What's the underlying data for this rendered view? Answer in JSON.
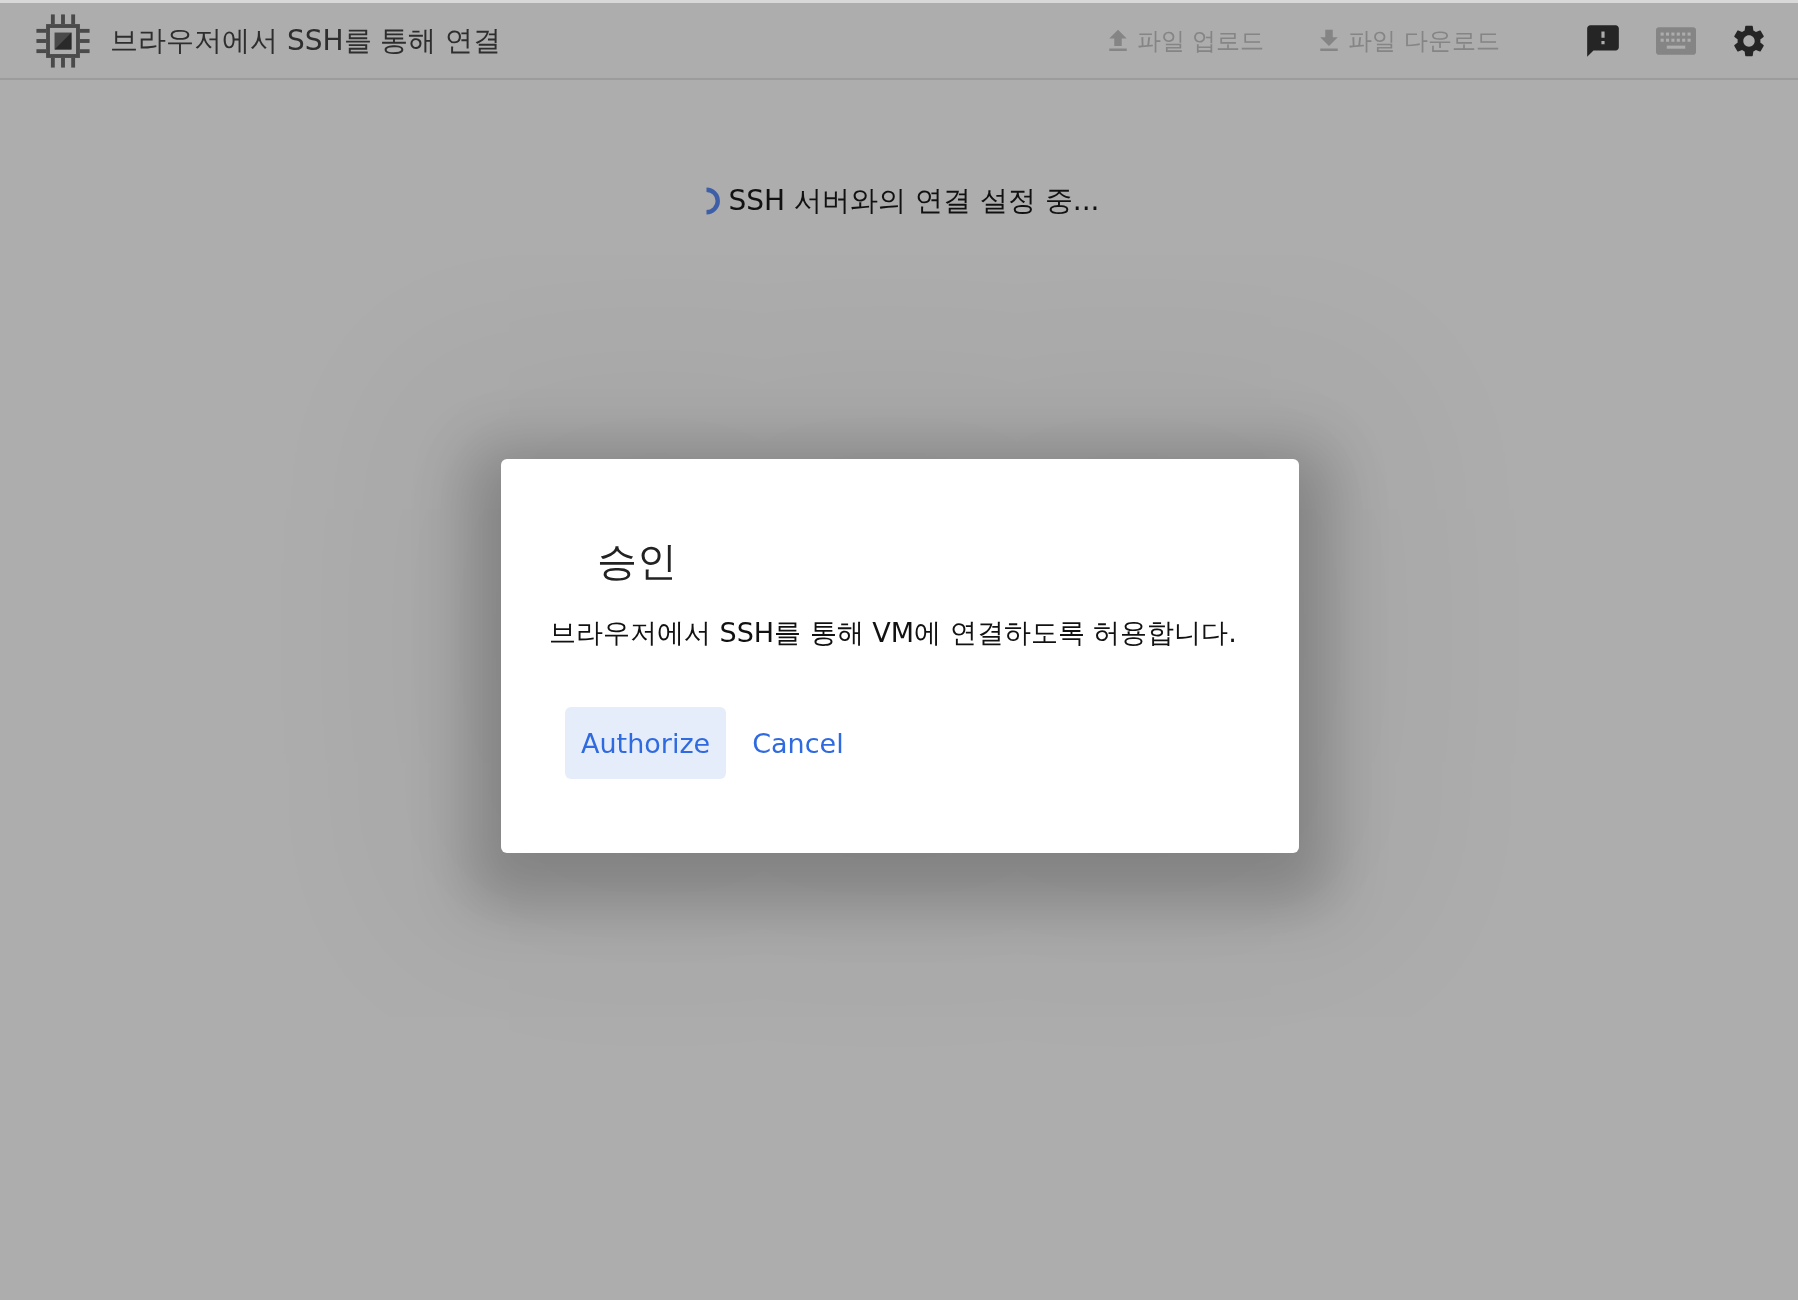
{
  "header": {
    "title": "브라우저에서 SSH를 통해 연결",
    "actions": [
      {
        "kind": "upload",
        "label": "파일 업로드",
        "disabled": true
      },
      {
        "kind": "download",
        "label": "파일 다운로드",
        "disabled": true
      }
    ],
    "icon_buttons": [
      {
        "kind": "feedback",
        "disabled": false
      },
      {
        "kind": "keyboard",
        "disabled": true
      },
      {
        "kind": "settings",
        "disabled": false
      }
    ]
  },
  "status": {
    "text": "SSH 서버와의 연결 설정 중..."
  },
  "dialog": {
    "title": "승인",
    "message": "브라우저에서 SSH를 통해 VM에 연결하도록 허용합니다.",
    "buttons": [
      {
        "label": "Authorize",
        "kind": "tonal"
      },
      {
        "label": "Cancel",
        "kind": "text"
      }
    ]
  }
}
